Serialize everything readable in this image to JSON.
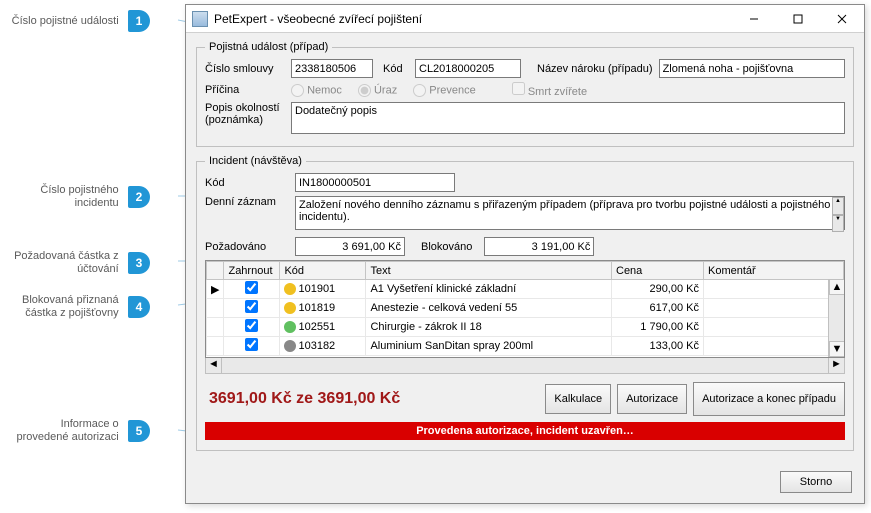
{
  "callouts": {
    "c1": {
      "num": "1",
      "text": "Číslo pojistné události"
    },
    "c2": {
      "num": "2",
      "text": "Číslo pojistného incidentu"
    },
    "c3": {
      "num": "3",
      "text": "Požadovaná částka z účtování"
    },
    "c4": {
      "num": "4",
      "text": "Blokovaná přiznaná částka z pojišťovny"
    },
    "c5": {
      "num": "5",
      "text": "Informace o provedené autorizaci"
    }
  },
  "window": {
    "title": "PetExpert - všeobecné zvířecí pojištení"
  },
  "case": {
    "legend": "Pojistná událost (případ)",
    "contract_lbl": "Číslo smlouvy",
    "contract_val": "2338180506",
    "code_lbl": "Kód",
    "code_val": "CL2018000205",
    "claim_lbl": "Název nároku (případu)",
    "claim_val": "Zlomená noha - pojišťovna",
    "cause_lbl": "Příčina",
    "cause_opts": {
      "illness": "Nemoc",
      "injury": "Úraz",
      "prevention": "Prevence"
    },
    "death_lbl": "Smrt zvířete",
    "desc_lbl": "Popis okolností (poznámka)",
    "desc_val": "Dodatečný popis"
  },
  "incident": {
    "legend": "Incident (návštěva)",
    "code_lbl": "Kód",
    "code_val": "IN1800000501",
    "daily_lbl": "Denní záznam",
    "daily_val": "Založení nového denního záznamu s přiřazeným případem (příprava pro tvorbu pojistné události a pojistného incidentu).",
    "requested_lbl": "Požadováno",
    "requested_val": "3 691,00 Kč",
    "blocked_lbl": "Blokováno",
    "blocked_val": "3 191,00 Kč",
    "columns": {
      "include": "Zahrnout",
      "code": "Kód",
      "text": "Text",
      "price": "Cena",
      "comment": "Komentář"
    },
    "rows": [
      {
        "indicator": "▶",
        "checked": true,
        "icon_color": "#f0c020",
        "code": "101901",
        "text": "A1 Vyšetření klinické základní",
        "price": "290,00 Kč",
        "comment": ""
      },
      {
        "indicator": "",
        "checked": true,
        "icon_color": "#f0c020",
        "code": "101819",
        "text": "Anestezie - celková vedení  55",
        "price": "617,00 Kč",
        "comment": ""
      },
      {
        "indicator": "",
        "checked": true,
        "icon_color": "#60c060",
        "code": "102551",
        "text": "Chirurgie - zákrok II 18",
        "price": "1 790,00 Kč",
        "comment": ""
      },
      {
        "indicator": "",
        "checked": true,
        "icon_color": "#888888",
        "code": "103182",
        "text": "Aluminium SanDitan spray 200ml",
        "price": "133,00 Kč",
        "comment": ""
      }
    ]
  },
  "summary": {
    "amount": "3691,00 Kč ze 3691,00 Kč",
    "btn_calc": "Kalkulace",
    "btn_auth": "Autorizace",
    "btn_authend": "Autorizace a konec případu",
    "status": "Provedena autorizace, incident uzavřen…"
  },
  "footer": {
    "storno": "Storno"
  }
}
